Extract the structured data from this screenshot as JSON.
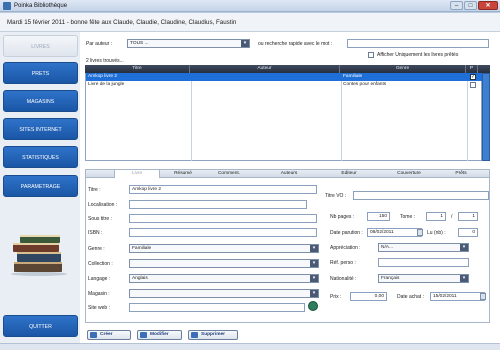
{
  "window": {
    "title": "Poinka Bibliothèque",
    "min": "–",
    "max": "□",
    "close": "✕"
  },
  "header": {
    "date_greeting": "Mardi 15 février 2011  -  bonne fête aux Claude, Claudie, Claudine, Claudius, Faustin"
  },
  "sidebar": {
    "items": [
      {
        "label": "LIVRES",
        "active": true
      },
      {
        "label": "PRETS"
      },
      {
        "label": "MAGASINS"
      },
      {
        "label": "SITES INTERNET"
      },
      {
        "label": "STATISTIQUES"
      },
      {
        "label": "PARAMETRAGE"
      }
    ],
    "quit": "QUITTER"
  },
  "search": {
    "author_label": "Par auteur :",
    "author_value": "TOUS ...",
    "quick_label": "ou recherche rapide avec le mot :",
    "quick_value": "",
    "only_available_label": "Afficher Uniquement les livres prêtés",
    "count_text": "2 livres trouvés..."
  },
  "grid": {
    "columns": [
      "Titre",
      "Auteur",
      "Genre",
      "P"
    ],
    "rows": [
      {
        "title": "Amkop livre 2",
        "author": "",
        "genre": "Familiale",
        "checked": true
      },
      {
        "title": "Livre de la jungle",
        "author": "",
        "genre": "Contes pour enfants",
        "checked": false
      }
    ]
  },
  "tabs": [
    "Livre",
    "Résumé",
    "Comment.",
    "Auteurs",
    "Editeur",
    "Couverture",
    "Prêts"
  ],
  "form": {
    "titre_label": "Titre :",
    "titre_value": "Amkop livre 2",
    "titre_vo_label": "Titre VO :",
    "titre_vo_value": "",
    "localisation_label": "Localisation :",
    "sous_titre_label": "Sous titre :",
    "isbn_label": "ISBN :",
    "genre_label": "Genre :",
    "genre_value": "Familiale",
    "collection_label": "Collection :",
    "langage_label": "Langage :",
    "langage_value": "Anglais",
    "magasin_label": "Magasin :",
    "site_web_label": "Site web :",
    "nb_pages_label": "Nb pages :",
    "nb_pages_value": "150",
    "tome_label": "Tome :",
    "tome_value": "1",
    "tome_sep": "/",
    "tome_total": "1",
    "date_parution_label": "Date parution :",
    "date_parution_value": "08/02/2011",
    "lu_label": "Lu (nb) :",
    "lu_value": "0",
    "appreciation_label": "Appréciation :",
    "appreciation_value": "N/A...",
    "ref_perso_label": "Réf. perso :",
    "nationalite_label": "Nationalité :",
    "nationalite_value": "Français",
    "prix_label": "Prix :",
    "prix_value": "0,00",
    "date_achat_label": "Date achat :",
    "date_achat_value": "15/02/2011"
  },
  "actions": {
    "create": "Créer",
    "modify": "Modifier",
    "delete": "Supprimer"
  },
  "colors": {
    "nav_blue": "#1f5fb4",
    "selected_row": "#1e6fd8",
    "grid_header": "#2f3849"
  }
}
